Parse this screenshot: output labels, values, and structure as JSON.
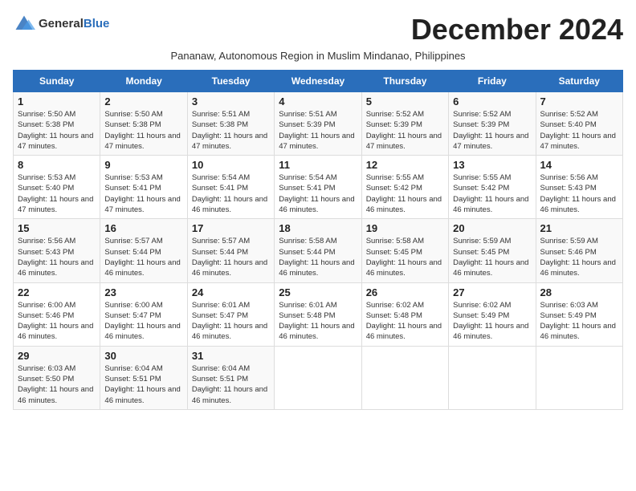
{
  "header": {
    "logo_general": "General",
    "logo_blue": "Blue",
    "month_title": "December 2024",
    "subtitle": "Pananaw, Autonomous Region in Muslim Mindanao, Philippines"
  },
  "days_of_week": [
    "Sunday",
    "Monday",
    "Tuesday",
    "Wednesday",
    "Thursday",
    "Friday",
    "Saturday"
  ],
  "weeks": [
    [
      {
        "day": "1",
        "sunrise": "Sunrise: 5:50 AM",
        "sunset": "Sunset: 5:38 PM",
        "daylight": "Daylight: 11 hours and 47 minutes."
      },
      {
        "day": "2",
        "sunrise": "Sunrise: 5:50 AM",
        "sunset": "Sunset: 5:38 PM",
        "daylight": "Daylight: 11 hours and 47 minutes."
      },
      {
        "day": "3",
        "sunrise": "Sunrise: 5:51 AM",
        "sunset": "Sunset: 5:38 PM",
        "daylight": "Daylight: 11 hours and 47 minutes."
      },
      {
        "day": "4",
        "sunrise": "Sunrise: 5:51 AM",
        "sunset": "Sunset: 5:39 PM",
        "daylight": "Daylight: 11 hours and 47 minutes."
      },
      {
        "day": "5",
        "sunrise": "Sunrise: 5:52 AM",
        "sunset": "Sunset: 5:39 PM",
        "daylight": "Daylight: 11 hours and 47 minutes."
      },
      {
        "day": "6",
        "sunrise": "Sunrise: 5:52 AM",
        "sunset": "Sunset: 5:39 PM",
        "daylight": "Daylight: 11 hours and 47 minutes."
      },
      {
        "day": "7",
        "sunrise": "Sunrise: 5:52 AM",
        "sunset": "Sunset: 5:40 PM",
        "daylight": "Daylight: 11 hours and 47 minutes."
      }
    ],
    [
      {
        "day": "8",
        "sunrise": "Sunrise: 5:53 AM",
        "sunset": "Sunset: 5:40 PM",
        "daylight": "Daylight: 11 hours and 47 minutes."
      },
      {
        "day": "9",
        "sunrise": "Sunrise: 5:53 AM",
        "sunset": "Sunset: 5:41 PM",
        "daylight": "Daylight: 11 hours and 47 minutes."
      },
      {
        "day": "10",
        "sunrise": "Sunrise: 5:54 AM",
        "sunset": "Sunset: 5:41 PM",
        "daylight": "Daylight: 11 hours and 46 minutes."
      },
      {
        "day": "11",
        "sunrise": "Sunrise: 5:54 AM",
        "sunset": "Sunset: 5:41 PM",
        "daylight": "Daylight: 11 hours and 46 minutes."
      },
      {
        "day": "12",
        "sunrise": "Sunrise: 5:55 AM",
        "sunset": "Sunset: 5:42 PM",
        "daylight": "Daylight: 11 hours and 46 minutes."
      },
      {
        "day": "13",
        "sunrise": "Sunrise: 5:55 AM",
        "sunset": "Sunset: 5:42 PM",
        "daylight": "Daylight: 11 hours and 46 minutes."
      },
      {
        "day": "14",
        "sunrise": "Sunrise: 5:56 AM",
        "sunset": "Sunset: 5:43 PM",
        "daylight": "Daylight: 11 hours and 46 minutes."
      }
    ],
    [
      {
        "day": "15",
        "sunrise": "Sunrise: 5:56 AM",
        "sunset": "Sunset: 5:43 PM",
        "daylight": "Daylight: 11 hours and 46 minutes."
      },
      {
        "day": "16",
        "sunrise": "Sunrise: 5:57 AM",
        "sunset": "Sunset: 5:44 PM",
        "daylight": "Daylight: 11 hours and 46 minutes."
      },
      {
        "day": "17",
        "sunrise": "Sunrise: 5:57 AM",
        "sunset": "Sunset: 5:44 PM",
        "daylight": "Daylight: 11 hours and 46 minutes."
      },
      {
        "day": "18",
        "sunrise": "Sunrise: 5:58 AM",
        "sunset": "Sunset: 5:44 PM",
        "daylight": "Daylight: 11 hours and 46 minutes."
      },
      {
        "day": "19",
        "sunrise": "Sunrise: 5:58 AM",
        "sunset": "Sunset: 5:45 PM",
        "daylight": "Daylight: 11 hours and 46 minutes."
      },
      {
        "day": "20",
        "sunrise": "Sunrise: 5:59 AM",
        "sunset": "Sunset: 5:45 PM",
        "daylight": "Daylight: 11 hours and 46 minutes."
      },
      {
        "day": "21",
        "sunrise": "Sunrise: 5:59 AM",
        "sunset": "Sunset: 5:46 PM",
        "daylight": "Daylight: 11 hours and 46 minutes."
      }
    ],
    [
      {
        "day": "22",
        "sunrise": "Sunrise: 6:00 AM",
        "sunset": "Sunset: 5:46 PM",
        "daylight": "Daylight: 11 hours and 46 minutes."
      },
      {
        "day": "23",
        "sunrise": "Sunrise: 6:00 AM",
        "sunset": "Sunset: 5:47 PM",
        "daylight": "Daylight: 11 hours and 46 minutes."
      },
      {
        "day": "24",
        "sunrise": "Sunrise: 6:01 AM",
        "sunset": "Sunset: 5:47 PM",
        "daylight": "Daylight: 11 hours and 46 minutes."
      },
      {
        "day": "25",
        "sunrise": "Sunrise: 6:01 AM",
        "sunset": "Sunset: 5:48 PM",
        "daylight": "Daylight: 11 hours and 46 minutes."
      },
      {
        "day": "26",
        "sunrise": "Sunrise: 6:02 AM",
        "sunset": "Sunset: 5:48 PM",
        "daylight": "Daylight: 11 hours and 46 minutes."
      },
      {
        "day": "27",
        "sunrise": "Sunrise: 6:02 AM",
        "sunset": "Sunset: 5:49 PM",
        "daylight": "Daylight: 11 hours and 46 minutes."
      },
      {
        "day": "28",
        "sunrise": "Sunrise: 6:03 AM",
        "sunset": "Sunset: 5:49 PM",
        "daylight": "Daylight: 11 hours and 46 minutes."
      }
    ],
    [
      {
        "day": "29",
        "sunrise": "Sunrise: 6:03 AM",
        "sunset": "Sunset: 5:50 PM",
        "daylight": "Daylight: 11 hours and 46 minutes."
      },
      {
        "day": "30",
        "sunrise": "Sunrise: 6:04 AM",
        "sunset": "Sunset: 5:51 PM",
        "daylight": "Daylight: 11 hours and 46 minutes."
      },
      {
        "day": "31",
        "sunrise": "Sunrise: 6:04 AM",
        "sunset": "Sunset: 5:51 PM",
        "daylight": "Daylight: 11 hours and 46 minutes."
      },
      null,
      null,
      null,
      null
    ]
  ]
}
